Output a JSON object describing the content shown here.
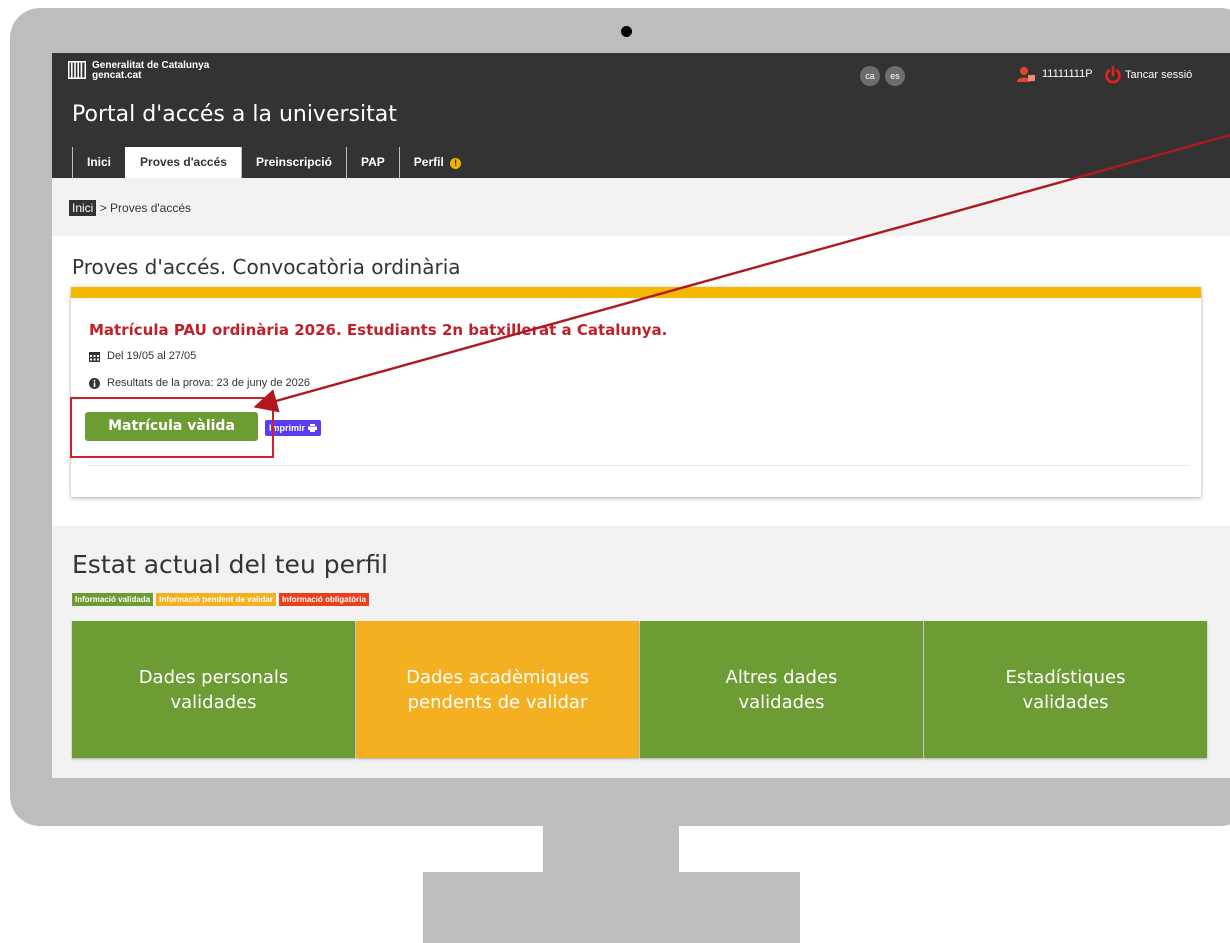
{
  "colors": {
    "topbar": "#333333",
    "validated": "#6d9b34",
    "pending": "#f5b021",
    "required": "#e8401c",
    "accent_yellow": "#f5b800",
    "title_red": "#c0202a",
    "print_button": "#5b3cf0",
    "annotation_red": "#d0202a"
  },
  "header": {
    "logo_line1": "Generalitat de Catalunya",
    "logo_line2": "gencat.cat",
    "portal_title": "Portal d'accés a la universitat",
    "languages": [
      "ca",
      "es"
    ],
    "user_id": "11111111P",
    "logout_label": "Tancar sessió"
  },
  "nav": {
    "tabs": [
      {
        "label": "Inici",
        "active": false
      },
      {
        "label": "Proves d'accés",
        "active": true
      },
      {
        "label": "Preinscripció",
        "active": false
      },
      {
        "label": "PAP",
        "active": false
      },
      {
        "label": "Perfil",
        "active": false,
        "badge": "!"
      }
    ]
  },
  "breadcrumb": {
    "home": "Inici",
    "current": "> Proves d'accés"
  },
  "main": {
    "section_title": "Proves d'accés. Convocatòria ordinària",
    "card": {
      "title": "Matrícula PAU ordinària 2026. Estudiants 2n batxillerat a Catalunya.",
      "dates": "Del 19/05 al 27/05",
      "results": "Resultats de la prova: 23 de juny de 2026",
      "valid_button": "Matrícula vàlida",
      "print_button": "Imprimir",
      "calendar_icon": "calendar-icon",
      "info_icon": "info-icon"
    }
  },
  "profile": {
    "title": "Estat actual del teu perfil",
    "legend": [
      {
        "label": "Informació validada",
        "color": "#6d9b34"
      },
      {
        "label": "Informació pendent de validar",
        "color": "#f5b021"
      },
      {
        "label": "Informació obligatòria",
        "color": "#e8401c"
      }
    ],
    "tiles": [
      {
        "label": "Dades personals validades",
        "color": "#6d9b34"
      },
      {
        "label": "Dades acadèmiques pendents de validar",
        "color": "#f5b021"
      },
      {
        "label": "Altres dades validades",
        "color": "#6d9b34"
      },
      {
        "label": "Estadístiques validades",
        "color": "#6d9b34"
      }
    ]
  }
}
